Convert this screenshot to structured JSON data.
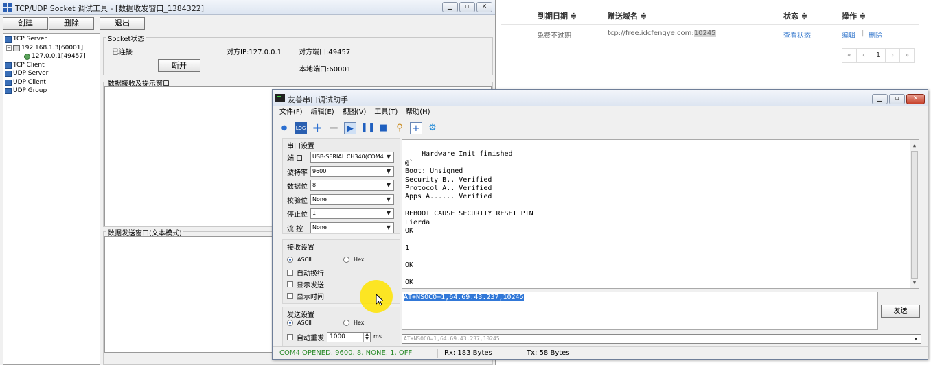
{
  "tcp_tool": {
    "title": "TCP/UDP Socket 调试工具 - [数据收发窗口_1384322]",
    "buttons": {
      "create": "创建",
      "delete": "删除",
      "exit": "退出"
    },
    "tree": [
      {
        "label": "TCP Server",
        "icon": "server-icon"
      },
      {
        "label": "192.168.1.3[60001]",
        "icon": "computer-icon"
      },
      {
        "label": "127.0.0.1[49457]",
        "icon": "connection-icon"
      },
      {
        "label": "TCP Client",
        "icon": "client-icon"
      },
      {
        "label": "UDP Server",
        "icon": "server-icon"
      },
      {
        "label": "UDP Client",
        "icon": "client-icon"
      },
      {
        "label": "UDP Group",
        "icon": "group-icon"
      }
    ],
    "socket": {
      "group_label": "Socket状态",
      "status": "已连接",
      "peer_ip": "对方IP:127.0.0.1",
      "peer_port": "对方端口:49457",
      "local_port": "本地端口:60001",
      "disconnect": "断开"
    },
    "recv_label": "数据接收及提示窗口",
    "send_label": "数据发送窗口(文本模式)"
  },
  "web": {
    "headers": {
      "expire": "到期日期 ≑",
      "domain": "赠送域名 ≑",
      "status": "状态 ≑",
      "actions": "操作 ≑"
    },
    "row": {
      "expire": "免费不过期",
      "domain_prefix": "tcp://free.idcfengye.com:",
      "domain_port": "10245",
      "status_link": "查看状态",
      "edit": "编辑",
      "sep": "|",
      "delete": "删除"
    },
    "pager": {
      "first": "«",
      "prev": "‹",
      "current": "1",
      "next": "›",
      "last": "»"
    }
  },
  "serial": {
    "title": "友善串口调试助手",
    "menu": [
      "文件(F)",
      "编辑(E)",
      "视图(V)",
      "工具(T)",
      "帮助(H)"
    ],
    "port_section": "串口设置",
    "fields": [
      {
        "label": "端  口",
        "value": "USB-SERIAL CH340(COM4)"
      },
      {
        "label": "波特率",
        "value": "9600"
      },
      {
        "label": "数据位",
        "value": "8"
      },
      {
        "label": "校验位",
        "value": "None"
      },
      {
        "label": "停止位",
        "value": "1"
      },
      {
        "label": "流  控",
        "value": "None"
      }
    ],
    "recv_section": "接收设置",
    "recv_ascii": "ASCII",
    "recv_hex": "Hex",
    "recv_options": [
      "自动换行",
      "显示发送",
      "显示时间"
    ],
    "send_section": "发送设置",
    "send_ascii": "ASCII",
    "send_hex": "Hex",
    "auto_resend": "自动重发",
    "interval": "1000",
    "interval_unit": "ms",
    "recv_text": "Hardware Init finished\n@`\nBoot: Unsigned\nSecurity B.. Verified\nProtocol A.. Verified\nApps A...... Verified\n\nREBOOT_CAUSE_SECURITY_RESET_PIN\nLierda\nOK\n\n1\n\nOK\n\nOK",
    "send_text": "AT+NSOCO=1,64.69.43.237,10245",
    "send_button": "发送",
    "history": "AT+NSOCO=1,64.69.43.237,10245",
    "status": {
      "port": "COM4 OPENED, 9600, 8, NONE, 1, OFF",
      "rx": "Rx: 183 Bytes",
      "tx": "Tx: 58 Bytes"
    }
  },
  "colors": {
    "accent": "#3c7dcf",
    "status_green": "#2a8a2a",
    "selection": "#3178d8",
    "cursor_highlight": "#ffe400"
  }
}
